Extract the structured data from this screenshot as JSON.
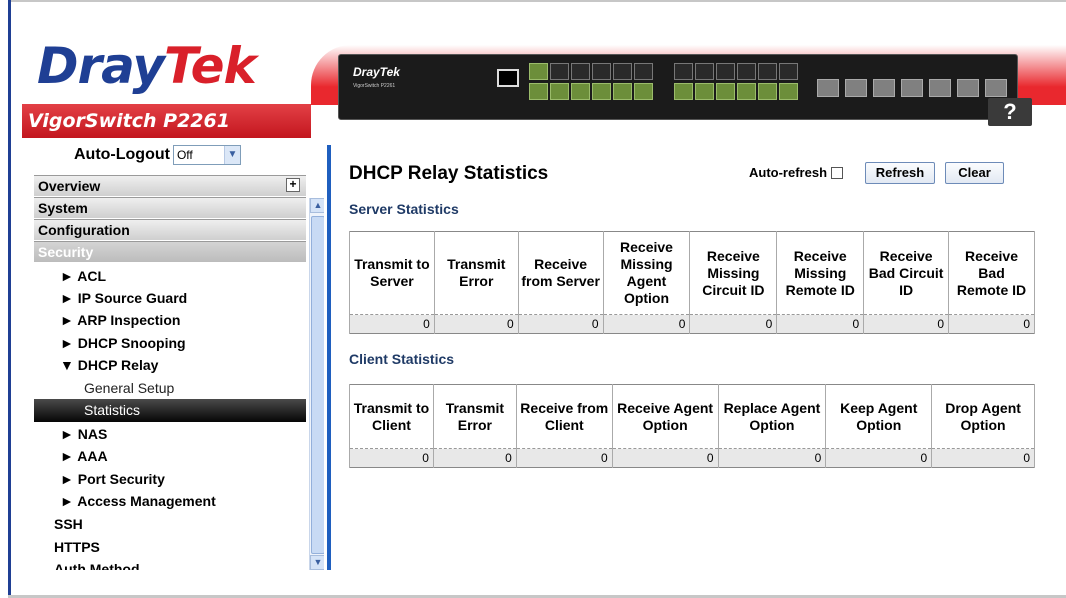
{
  "brand": {
    "dray": "Dray",
    "tek": "Tek",
    "model": "VigorSwitch P2261"
  },
  "device": {
    "brand": "DrayTek",
    "sub": "VigorSwitch P2261",
    "help_label": "?"
  },
  "sidebar": {
    "autologout_label": "Auto-Logout",
    "autologout_value": "Off",
    "groups": [
      {
        "label": "Overview"
      },
      {
        "label": "System"
      },
      {
        "label": "Configuration"
      },
      {
        "label": "Security"
      }
    ],
    "items": [
      {
        "label": "► ACL"
      },
      {
        "label": "► IP Source Guard"
      },
      {
        "label": "► ARP Inspection"
      },
      {
        "label": "► DHCP Snooping"
      },
      {
        "label": "▼ DHCP Relay"
      },
      {
        "label": "► NAS"
      },
      {
        "label": "► AAA"
      },
      {
        "label": "► Port Security"
      },
      {
        "label": "► Access Management"
      },
      {
        "label": "SSH"
      },
      {
        "label": "HTTPS"
      },
      {
        "label": "Auth Method"
      }
    ],
    "subitems": [
      {
        "label": "General Setup"
      },
      {
        "label": "Statistics"
      }
    ]
  },
  "main": {
    "title": "DHCP Relay Statistics",
    "autorefresh_label": "Auto-refresh",
    "refresh_label": "Refresh",
    "clear_label": "Clear",
    "server_section": "Server Statistics",
    "client_section": "Client Statistics",
    "server_headers": [
      "Transmit to Server",
      "Transmit Error",
      "Receive from Server",
      "Receive Missing Agent Option",
      "Receive Missing Circuit ID",
      "Receive Missing Remote ID",
      "Receive Bad Circuit ID",
      "Receive Bad Remote ID"
    ],
    "server_values": [
      "0",
      "0",
      "0",
      "0",
      "0",
      "0",
      "0",
      "0"
    ],
    "client_headers": [
      "Transmit to Client",
      "Transmit Error",
      "Receive from Client",
      "Receive Agent Option",
      "Replace Agent Option",
      "Keep Agent Option",
      "Drop Agent Option"
    ],
    "client_values": [
      "0",
      "0",
      "0",
      "0",
      "0",
      "0",
      "0"
    ]
  }
}
